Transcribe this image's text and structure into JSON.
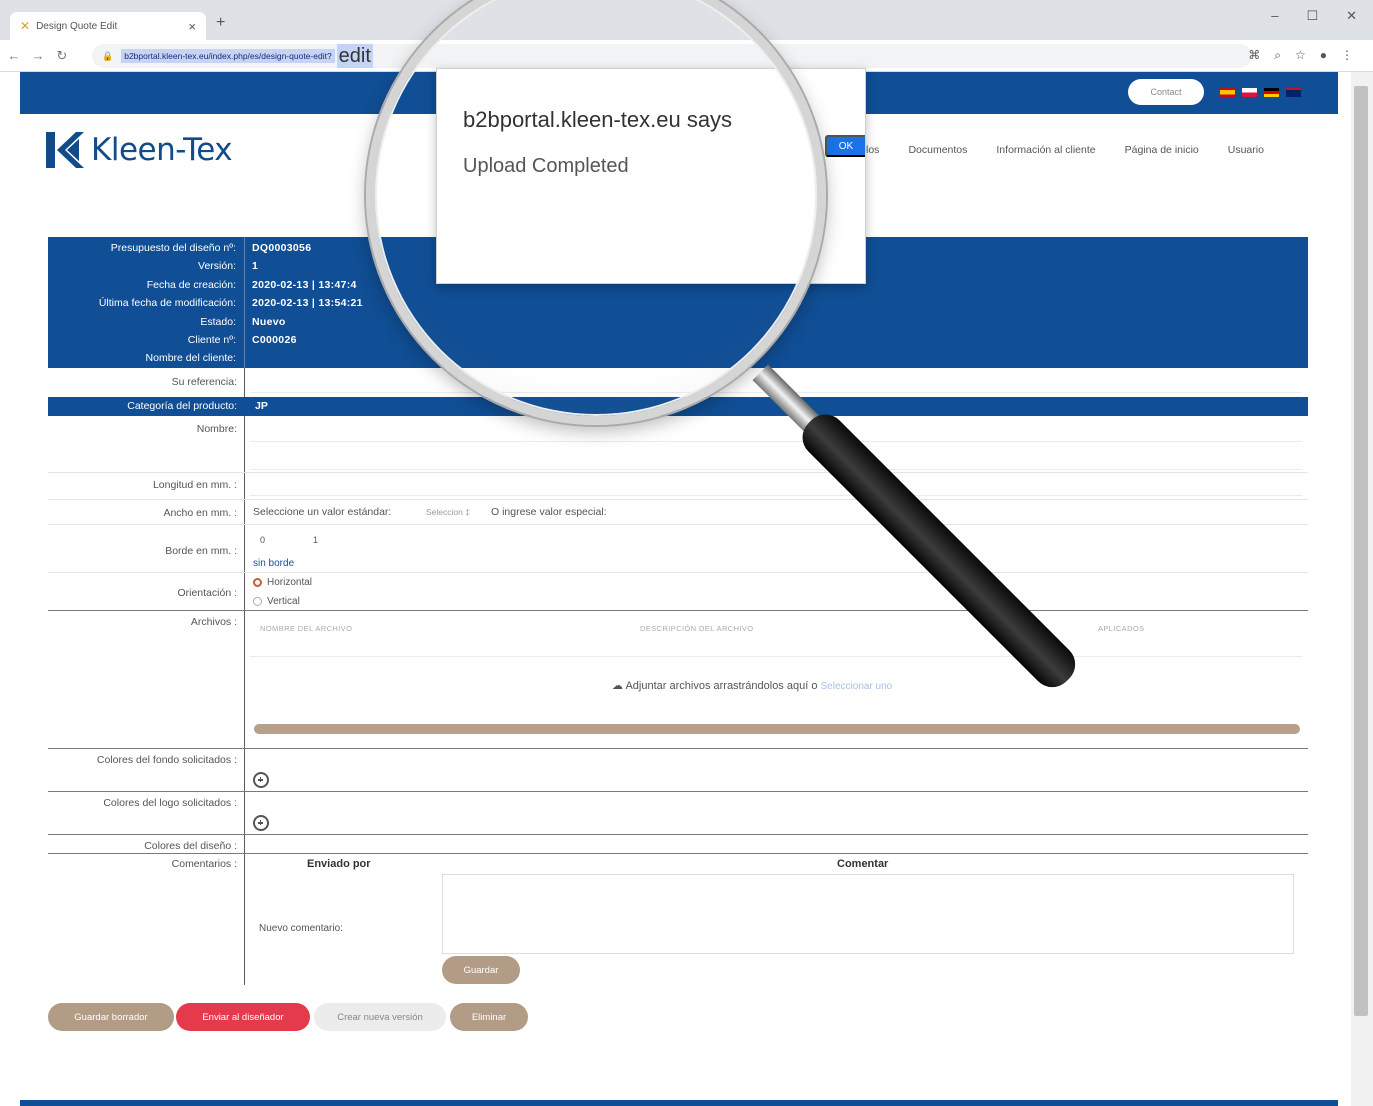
{
  "browser": {
    "tab_title": "Design Quote Edit",
    "url": "b2bportal.kleen-tex.eu/index.php/es/design-quote-edit?",
    "url_magnified": "edit"
  },
  "header": {
    "contact_label": "Contact",
    "brand": "Kleen-Tex",
    "nav": [
      "los",
      "Documentos",
      "Información al cliente",
      "Página de inicio",
      "Usuario"
    ],
    "flag_colors": [
      "#e8a317",
      "#d7263d",
      "#2e2e2e",
      "#2a4a9a"
    ]
  },
  "info": {
    "rows": [
      {
        "label": "Presupuesto del diseño nº:",
        "value": "DQ0003056"
      },
      {
        "label": "Versión:",
        "value": "1"
      },
      {
        "label": "Fecha de creación:",
        "value": "2020-02-13 | 13:47:4"
      },
      {
        "label": "Última fecha de modificación:",
        "value": "2020-02-13 | 13:54:21"
      },
      {
        "label": "Estado:",
        "value": "Nuevo"
      },
      {
        "label": "Cliente nº:",
        "value": "C000026"
      },
      {
        "label": "Nombre del cliente:",
        "value": ""
      }
    ]
  },
  "form": {
    "reference_label": "Su referencia:",
    "category_label": "Categoría del producto:",
    "category_value": "JP",
    "name_label": "Nombre:",
    "length_label": "Longitud en mm. :",
    "width_label": "Ancho en mm. :",
    "width_std_text": "Seleccione un valor estándar:",
    "width_select": "Seleccion ‡",
    "width_special_text": "O ingrese valor especial:",
    "border_label": "Borde en mm. :",
    "border_v1": "0",
    "border_v2": "1",
    "border_link": "sin borde",
    "orientation_label": "Orientación :",
    "orientation_h": "Horizontal",
    "orientation_v": "Vertical",
    "files_label": "Archivos :",
    "files_headers": [
      "NOMBRE DEL ARCHIVO",
      "DESCRIPCIÓN DEL ARCHIVO",
      "APLICADOS"
    ],
    "upload_text": "Adjuntar archivos arrastrándolos aquí o",
    "upload_link": "Seleccionar uno",
    "upload_progress": 1.0,
    "bg_colors_label": "Colores del fondo solicitados :",
    "logo_colors_label": "Colores del logo solicitados :",
    "design_colors_label": "Colores del diseño :",
    "comments_label": "Comentarios :",
    "sent_by_header": "Enviado por",
    "comment_header": "Comentar",
    "new_comment_label": "Nuevo comentario:",
    "save_comment_btn": "Guardar"
  },
  "actions": {
    "save_draft": "Guardar borrador",
    "send_designer": "Enviar al diseñador",
    "new_version": "Crear nueva versión",
    "delete": "Eliminar"
  },
  "dialog": {
    "title": "b2bportal.kleen-tex.eu says",
    "message": "Upload Completed",
    "ok_label": "OK"
  }
}
